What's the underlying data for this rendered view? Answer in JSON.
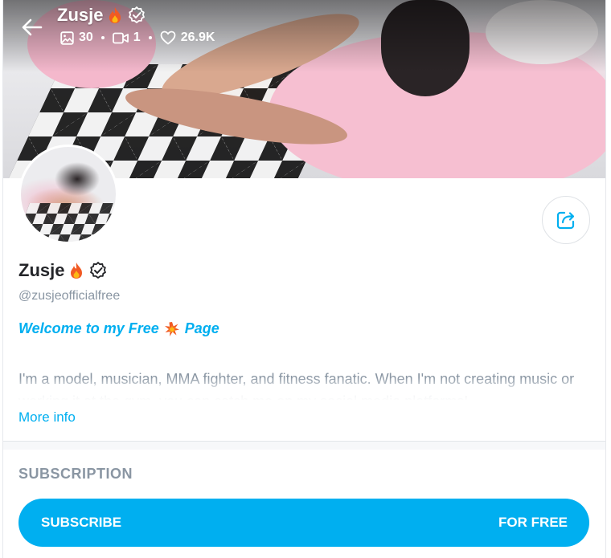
{
  "header": {
    "name": "Zusje",
    "stats": {
      "photos": "30",
      "videos": "1",
      "likes": "26.9K"
    }
  },
  "profile": {
    "name": "Zusje",
    "handle": "@zusjeofficialfree",
    "welcome_prefix": "Welcome to my Free",
    "welcome_suffix": "Page",
    "bio": "I'm a model, musician, MMA fighter, and fitness fanatic. When I'm not creating music or working it at the gym, you can catch me on my social media platforms!",
    "more_info": "More info"
  },
  "subscription": {
    "title": "SUBSCRIPTION",
    "button_label": "SUBSCRIBE",
    "price_label": "FOR FREE"
  },
  "colors": {
    "accent": "#00aff0",
    "muted": "#8a96a3",
    "text": "#242529",
    "fire": "#f15a24"
  }
}
